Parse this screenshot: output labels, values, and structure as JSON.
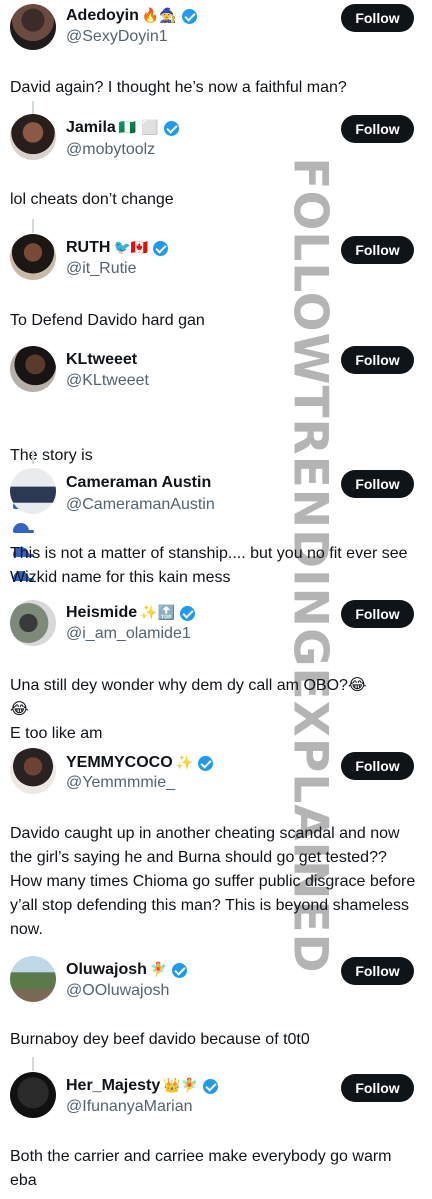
{
  "follow_label": "Follow",
  "tweets": [
    {
      "name": "Adedoyin",
      "emojis": "🔥🧙",
      "verified": true,
      "handle": "@SexyDoyin1",
      "text": "David again? I thought he’s now a faithful man?"
    },
    {
      "name": "Jamila",
      "emojis": "🇳🇬 ⬜",
      "verified": true,
      "handle": "@mobytoolz",
      "text": "lol cheats don’t change"
    },
    {
      "name": "RUTH",
      "emojis": "🐦🇨🇦",
      "verified": true,
      "handle": "@it_Rutie",
      "text": "To Defend Davido hard gan"
    },
    {
      "name": "KLtweeet",
      "emojis": "",
      "verified": false,
      "handle": "@KLtweeet",
      "text": "The story is"
    },
    {
      "name": "Cameraman Austin",
      "emojis": "",
      "verified": false,
      "handle": "@CameramanAustin",
      "text": "This is not a matter of stanship.... but you no fit ever see Wizkid name for this kain mess"
    },
    {
      "name": "Heismide",
      "emojis": "✨🔝",
      "verified": true,
      "handle": "@i_am_olamide1",
      "text": "Una still dey wonder why dem dy call am OBO?😂\n😂\nE too like am"
    },
    {
      "name": "YEMMYCOCO",
      "emojis": "✨",
      "verified": true,
      "handle": "@Yemmmmie_",
      "text": "Davido caught up in another cheating scandal and now the girl’s saying he and Burna should go get tested?? How many times Chioma go suffer public disgrace before y’all stop defending this man? This is beyond shameless now."
    },
    {
      "name": "Oluwajosh",
      "emojis": "🧚",
      "verified": true,
      "handle": "@OOluwajosh",
      "text": "Burnaboy dey beef davido because of t0t0"
    },
    {
      "name": "Her_Majesty",
      "emojis": "👑🧚",
      "verified": true,
      "handle": "@IfunanyaMarian",
      "text": "Both the carrier and carriee make everybody go warm eba"
    }
  ],
  "watermark": "FOLLOWTRENDINGEXPLAINED",
  "colors": {
    "text": "#0f1419",
    "secondary": "#536471",
    "verified": "#1d9bf0",
    "button_bg": "#0f1419",
    "watermark": "#8c8c8c"
  }
}
